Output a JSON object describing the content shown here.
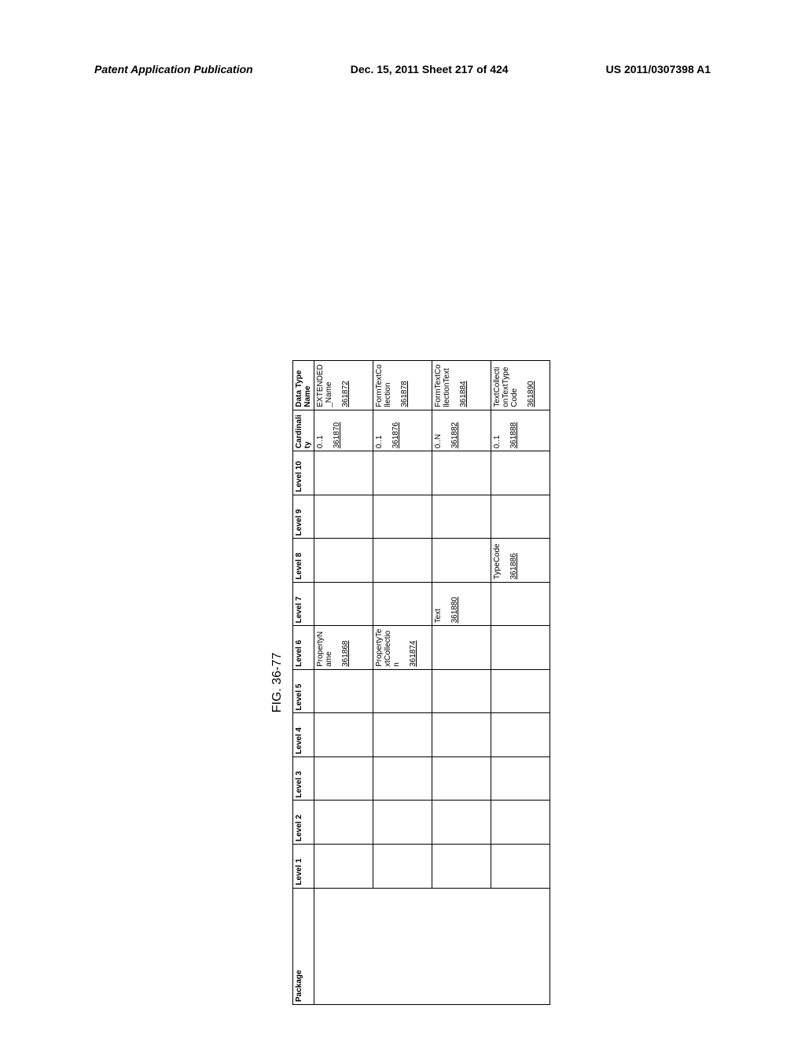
{
  "header": {
    "left": "Patent Application Publication",
    "center": "Dec. 15, 2011  Sheet 217 of 424",
    "right": "US 2011/0307398 A1"
  },
  "figure_label": "FIG. 36-77",
  "table": {
    "headers": {
      "package": "Package",
      "level1": "Level 1",
      "level2": "Level 2",
      "level3": "Level 3",
      "level4": "Level 4",
      "level5": "Level 5",
      "level6": "Level 6",
      "level7": "Level 7",
      "level8": "Level 8",
      "level9": "Level 9",
      "level10": "Level 10",
      "cardinality": "Cardinality",
      "datatype": "Data Type Name"
    },
    "rows": [
      {
        "level6": "PropertyName",
        "level6_ref": "361868",
        "cardinality": "0..1",
        "cardinality_ref": "361870",
        "datatype": "EXTENDED_Name",
        "datatype_ref": "361872"
      },
      {
        "level6": "PropertyTextCollection",
        "level6_ref": "361874",
        "cardinality": "0..1",
        "cardinality_ref": "361876",
        "datatype": "FormTextCollection",
        "datatype_ref": "361878"
      },
      {
        "level7": "Text",
        "level7_ref": "361880",
        "cardinality": "0..N",
        "cardinality_ref": "361882",
        "datatype": "FormTextCollectionText",
        "datatype_ref": "361884"
      },
      {
        "level8": "TypeCode",
        "level8_ref": "361886",
        "cardinality": "0..1",
        "cardinality_ref": "361888",
        "datatype": "TextCollectionTextTypeCode",
        "datatype_ref": "361890"
      }
    ]
  }
}
